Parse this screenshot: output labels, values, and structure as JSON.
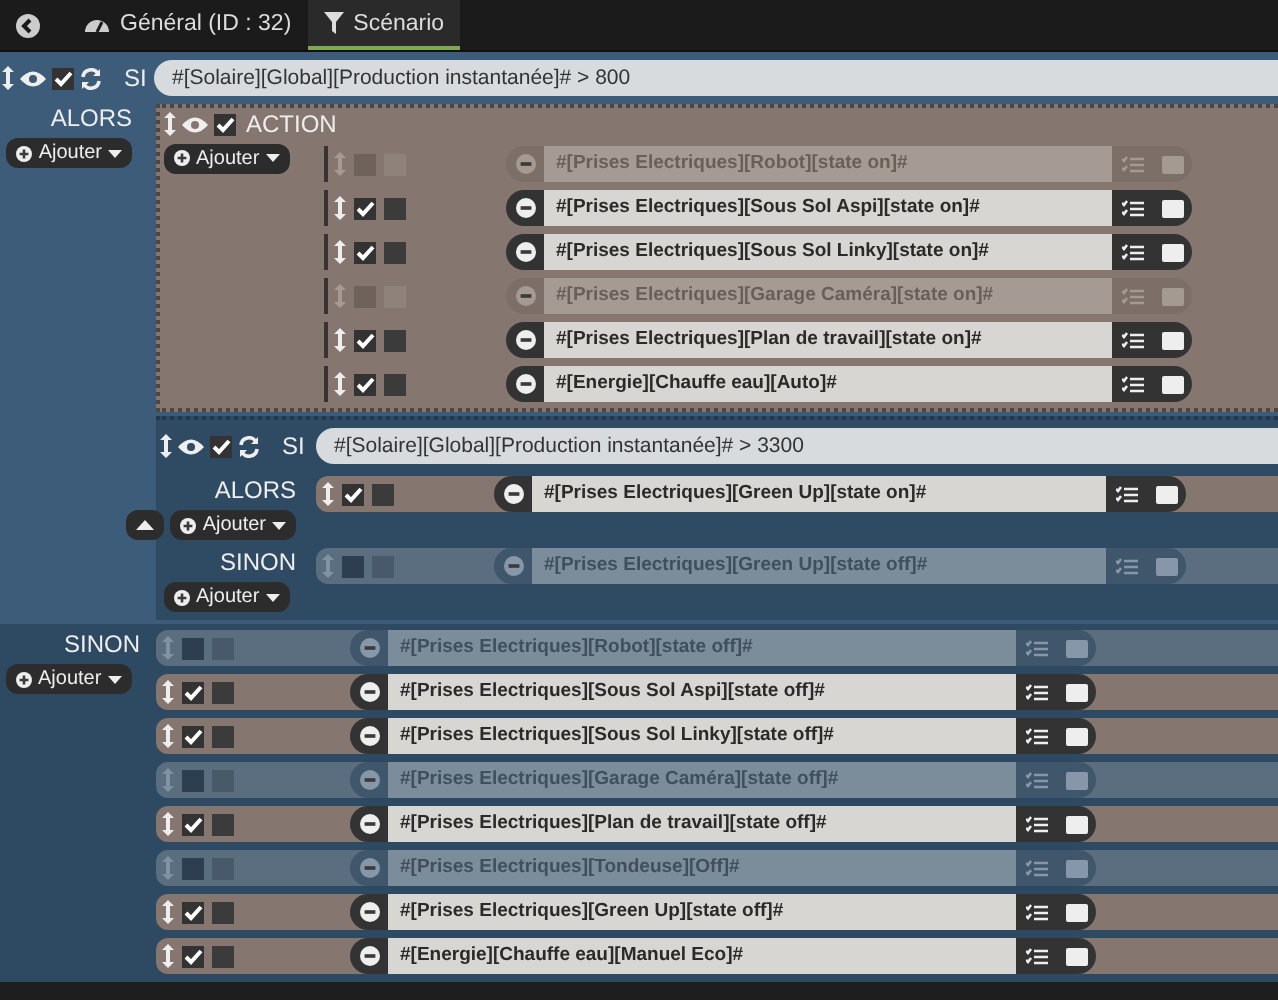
{
  "tabs": [
    {
      "label": "Général (ID : 32)",
      "selected": false
    },
    {
      "label": "Scénario",
      "selected": true
    }
  ],
  "scenario": {
    "si_label": "SI",
    "enabled": true,
    "condition": "#[Solaire][Global][Production instantanée]# > 800",
    "alors_label": "ALORS",
    "add_label": "Ajouter",
    "action_block": {
      "title": "ACTION",
      "enabled": true,
      "add_label": "Ajouter",
      "actions": [
        {
          "text": "#[Prises Electriques][Robot][state on]#",
          "enabled": false,
          "option_checked": false
        },
        {
          "text": "#[Prises Electriques][Sous Sol Aspi][state on]#",
          "enabled": true,
          "option_checked": false
        },
        {
          "text": "#[Prises Electriques][Sous Sol Linky][state on]#",
          "enabled": true,
          "option_checked": false
        },
        {
          "text": "#[Prises Electriques][Garage Caméra][state on]#",
          "enabled": false,
          "option_checked": false
        },
        {
          "text": "#[Prises Electriques][Plan de travail][state on]#",
          "enabled": true,
          "option_checked": false
        },
        {
          "text": "#[Energie][Chauffe eau][Auto]#",
          "enabled": true,
          "option_checked": false
        }
      ]
    },
    "nested": {
      "si_label": "SI",
      "enabled": true,
      "condition": "#[Solaire][Global][Production instantanée]# > 3300",
      "alors_label": "ALORS",
      "alors_add": "Ajouter",
      "alors_actions": [
        {
          "text": "#[Prises Electriques][Green Up][state on]#",
          "enabled": true,
          "option_checked": false
        }
      ],
      "sinon_label": "SINON",
      "sinon_add": "Ajouter",
      "sinon_actions": [
        {
          "text": "#[Prises Electriques][Green Up][state off]#",
          "enabled": false,
          "option_checked": false
        }
      ]
    },
    "sinon_label": "SINON",
    "sinon_add": "Ajouter",
    "sinon_actions": [
      {
        "text": "#[Prises Electriques][Robot][state off]#",
        "enabled": false,
        "option_checked": false
      },
      {
        "text": "#[Prises Electriques][Sous Sol Aspi][state off]#",
        "enabled": true,
        "option_checked": false
      },
      {
        "text": "#[Prises Electriques][Sous Sol Linky][state off]#",
        "enabled": true,
        "option_checked": false
      },
      {
        "text": "#[Prises Electriques][Garage Caméra][state off]#",
        "enabled": false,
        "option_checked": false
      },
      {
        "text": "#[Prises Electriques][Plan de travail][state off]#",
        "enabled": true,
        "option_checked": false
      },
      {
        "text": "#[Prises Electriques][Tondeuse][Off]#",
        "enabled": false,
        "option_checked": false
      },
      {
        "text": "#[Prises Electriques][Green Up][state off]#",
        "enabled": true,
        "option_checked": false
      },
      {
        "text": "#[Energie][Chauffe eau][Manuel Eco]#",
        "enabled": true,
        "option_checked": false
      }
    ]
  }
}
